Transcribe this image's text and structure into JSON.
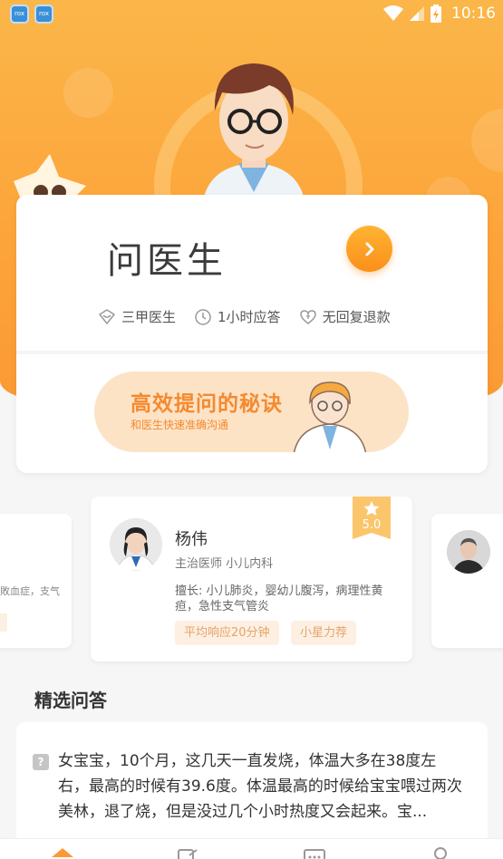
{
  "status_bar": {
    "time": "10:16",
    "left_apps": [
      "rox",
      "rox"
    ]
  },
  "ask_card": {
    "title": "问医生",
    "features": [
      {
        "icon": "shield-heart-icon",
        "label": "三甲医生"
      },
      {
        "icon": "clock-icon",
        "label": "1小时应答"
      },
      {
        "icon": "refund-icon",
        "label": "无回复退款"
      }
    ],
    "banner": {
      "title": "高效提问的秘诀",
      "subtitle": "和医生快速准确沟通"
    }
  },
  "doctor_carousel": {
    "left_snippet": "敗血症，支气",
    "featured": {
      "name": "杨伟",
      "title": "主治医师  小儿内科",
      "specialty": "擅长: 小儿肺炎，婴幼儿腹泻，病理性黄疸，急性支气管炎",
      "rating": "5.0",
      "tags": [
        "平均响应20分钟",
        "小星力荐"
      ]
    }
  },
  "qa_section": {
    "title": "精选问答",
    "question": "女宝宝，10个月，这几天一直发烧，体温大多在38度左右，最高的时候有39.6度。体温最高的时候给宝宝喂过两次美林，退了烧，但是没过几个小时热度又会起来。宝..."
  },
  "colors": {
    "accent": "#fb9a35",
    "tag_text": "#e5a36a",
    "tag_bg": "#fdf0e2"
  }
}
